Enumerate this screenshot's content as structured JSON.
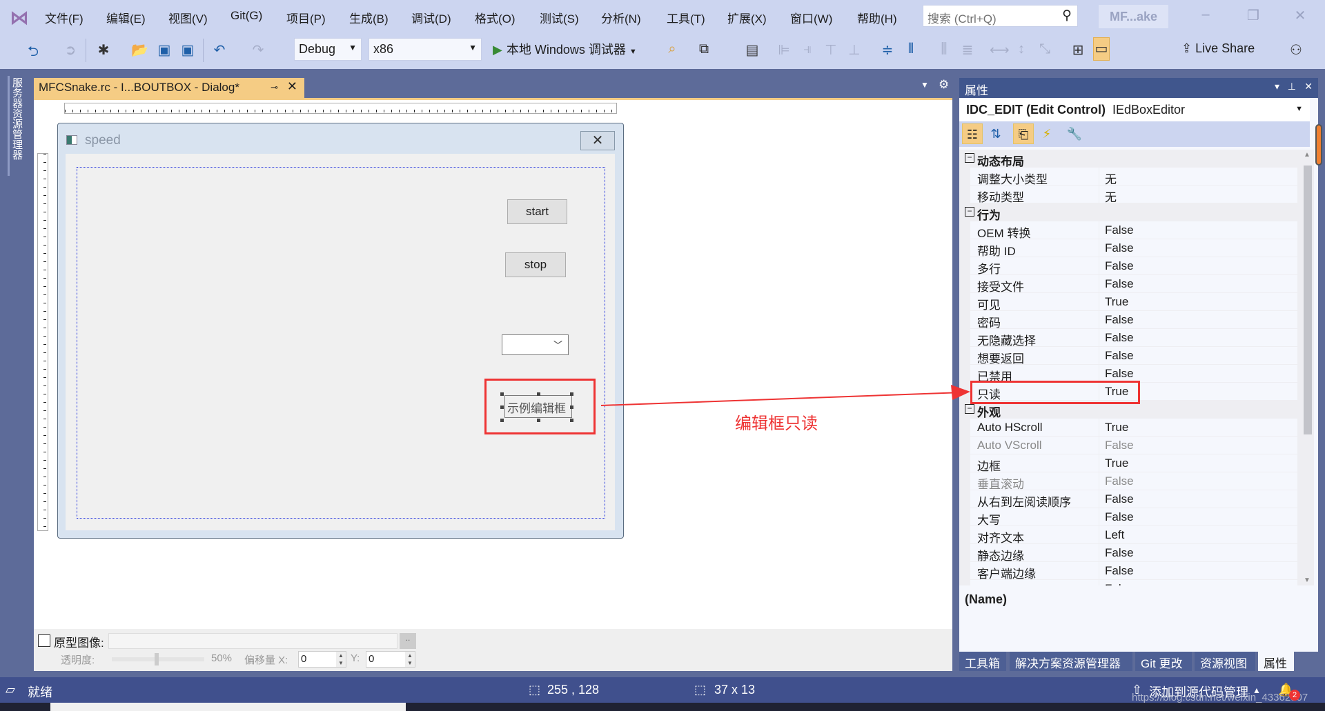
{
  "menubar": {
    "items": [
      "文件(F)",
      "编辑(E)",
      "视图(V)",
      "Git(G)",
      "项目(P)",
      "生成(B)",
      "调试(D)",
      "格式(O)",
      "测试(S)",
      "分析(N)",
      "工具(T)",
      "扩展(X)",
      "窗口(W)",
      "帮助(H)"
    ],
    "search_placeholder": "搜索 (Ctrl+Q)",
    "solution_name": "MF...ake",
    "window_controls": {
      "minimize": "–",
      "restore": "❐",
      "close": "✕"
    }
  },
  "toolbar": {
    "configuration": "Debug",
    "platform": "x86",
    "run_label": "本地 Windows 调试器",
    "live_share": "Live Share",
    "icons": [
      "back-icon",
      "forward-icon",
      "new-project-icon",
      "open-icon",
      "save-icon",
      "save-all-icon",
      "undo-icon",
      "redo-icon"
    ]
  },
  "sidebar": {
    "server_explorer": "服务器资源管理器"
  },
  "document_tab": {
    "title": "MFCSnake.rc - I...BOUTBOX - Dialog*",
    "pin": "⊸",
    "close": "✕"
  },
  "dialog": {
    "title": "speed",
    "close": "✕",
    "start_label": "start",
    "stop_label": "stop",
    "edit_text": "示例编辑框"
  },
  "annotation": {
    "text": "编辑框只读",
    "color": "#ee3333"
  },
  "editor_bottom": {
    "prototype_label": "原型图像:",
    "browse": "..",
    "opacity_label": "透明度:",
    "opacity_value": "50%",
    "opacity_fraction": 0.5,
    "offset_x_label": "偏移量 X:",
    "offset_x": "0",
    "offset_y_label": "Y:",
    "offset_y": "0"
  },
  "properties": {
    "title": "属性",
    "object_name": "IDC_EDIT (Edit Control)",
    "object_type": "IEdBoxEditor",
    "rows": [
      {
        "category": "动态布局"
      },
      {
        "name": "调整大小类型",
        "value": "无"
      },
      {
        "name": "移动类型",
        "value": "无"
      },
      {
        "category": "行为"
      },
      {
        "name": "OEM 转换",
        "value": "False"
      },
      {
        "name": "帮助 ID",
        "value": "False"
      },
      {
        "name": "多行",
        "value": "False"
      },
      {
        "name": "接受文件",
        "value": "False"
      },
      {
        "name": "可见",
        "value": "True"
      },
      {
        "name": "密码",
        "value": "False"
      },
      {
        "name": "无隐藏选择",
        "value": "False"
      },
      {
        "name": "想要返回",
        "value": "False"
      },
      {
        "name": "已禁用",
        "value": "False"
      },
      {
        "name": "只读",
        "value": "True"
      },
      {
        "category": "外观"
      },
      {
        "name": "Auto HScroll",
        "value": "True"
      },
      {
        "name": "Auto VScroll",
        "value": "False",
        "disabled": true
      },
      {
        "name": "边框",
        "value": "True"
      },
      {
        "name": "垂直滚动",
        "value": "False",
        "disabled": true
      },
      {
        "name": "从右到左阅读顺序",
        "value": "False"
      },
      {
        "name": "大写",
        "value": "False"
      },
      {
        "name": "对齐文本",
        "value": "Left"
      },
      {
        "name": "静态边缘",
        "value": "False"
      },
      {
        "name": "客户端边缘",
        "value": "False"
      },
      {
        "name": "模式框架",
        "value": "False"
      }
    ],
    "description_title": "(Name)"
  },
  "bottom_tabs": [
    "工具箱",
    "解决方案资源管理器",
    "Git 更改",
    "资源视图",
    "属性"
  ],
  "statusbar": {
    "status": "就绪",
    "position": "255 , 128",
    "size": "37 x 13",
    "source_control": "添加到源代码管理",
    "watermark": "https://blog.csdn.net/weixin_43362507",
    "notification_count": "2"
  },
  "colors": {
    "accent_tab": "#f5cc84",
    "statusbar": "#40508d",
    "chrome": "#ccd5f0",
    "highlight": "#ee3333"
  }
}
